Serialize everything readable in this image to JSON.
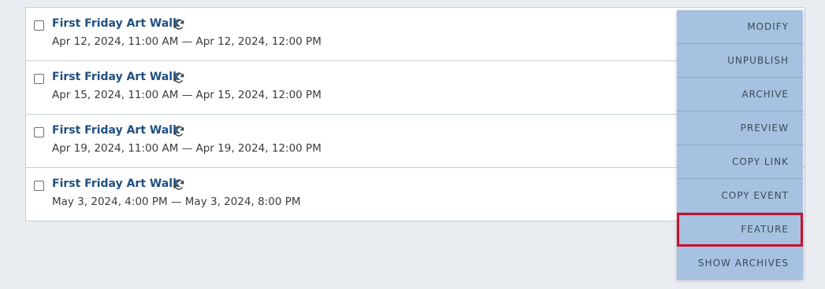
{
  "events": [
    {
      "title": "First Friday Art Walk",
      "dates": "Apr 12, 2024, 11:00 AM — Apr 12, 2024, 12:00 PM"
    },
    {
      "title": "First Friday Art Walk",
      "dates": "Apr 15, 2024, 11:00 AM — Apr 15, 2024, 12:00 PM"
    },
    {
      "title": "First Friday Art Walk",
      "dates": "Apr 19, 2024, 11:00 AM — Apr 19, 2024, 12:00 PM"
    },
    {
      "title": "First Friday Art Walk",
      "dates": "May 3, 2024, 4:00 PM — May 3, 2024, 8:00 PM"
    }
  ],
  "menu": {
    "items": [
      {
        "label": "MODIFY"
      },
      {
        "label": "UNPUBLISH"
      },
      {
        "label": "ARCHIVE"
      },
      {
        "label": "PREVIEW"
      },
      {
        "label": "COPY LINK"
      },
      {
        "label": "COPY EVENT"
      },
      {
        "label": "FEATURE"
      },
      {
        "label": "SHOW ARCHIVES"
      }
    ]
  },
  "colors": {
    "menu_background": "#a7c2e0",
    "highlight_border": "#c8102e",
    "event_title": "#1f5082"
  },
  "icons": {
    "recurring": "recurring-icon"
  }
}
